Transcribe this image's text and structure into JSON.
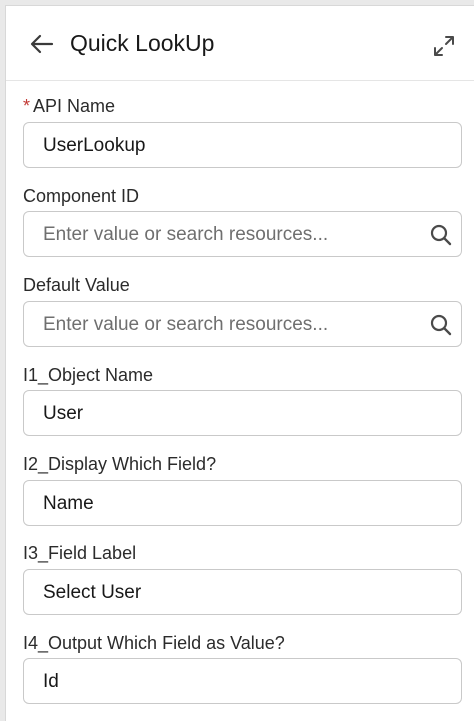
{
  "header": {
    "title": "Quick LookUp",
    "back_icon": "arrow-left-icon",
    "expand_icon": "expand-icon"
  },
  "fields": {
    "api_name": {
      "label": "API Name",
      "required_mark": "*",
      "value": "UserLookup"
    },
    "component_id": {
      "label": "Component ID",
      "placeholder": "Enter value or search resources...",
      "icon": "search-icon"
    },
    "default_value": {
      "label": "Default Value",
      "placeholder": "Enter value or search resources...",
      "icon": "search-icon"
    },
    "object_name": {
      "label": "I1_Object Name",
      "value": "User"
    },
    "display_field": {
      "label": "I2_Display Which Field?",
      "value": "Name"
    },
    "field_label": {
      "label": "I3_Field Label",
      "value": "Select User"
    },
    "output_field": {
      "label": "I4_Output Which Field as Value?",
      "value": "Id"
    }
  },
  "colors": {
    "required": "#c23934",
    "border": "#c9c9c9",
    "placeholder": "#6f6f6f"
  }
}
